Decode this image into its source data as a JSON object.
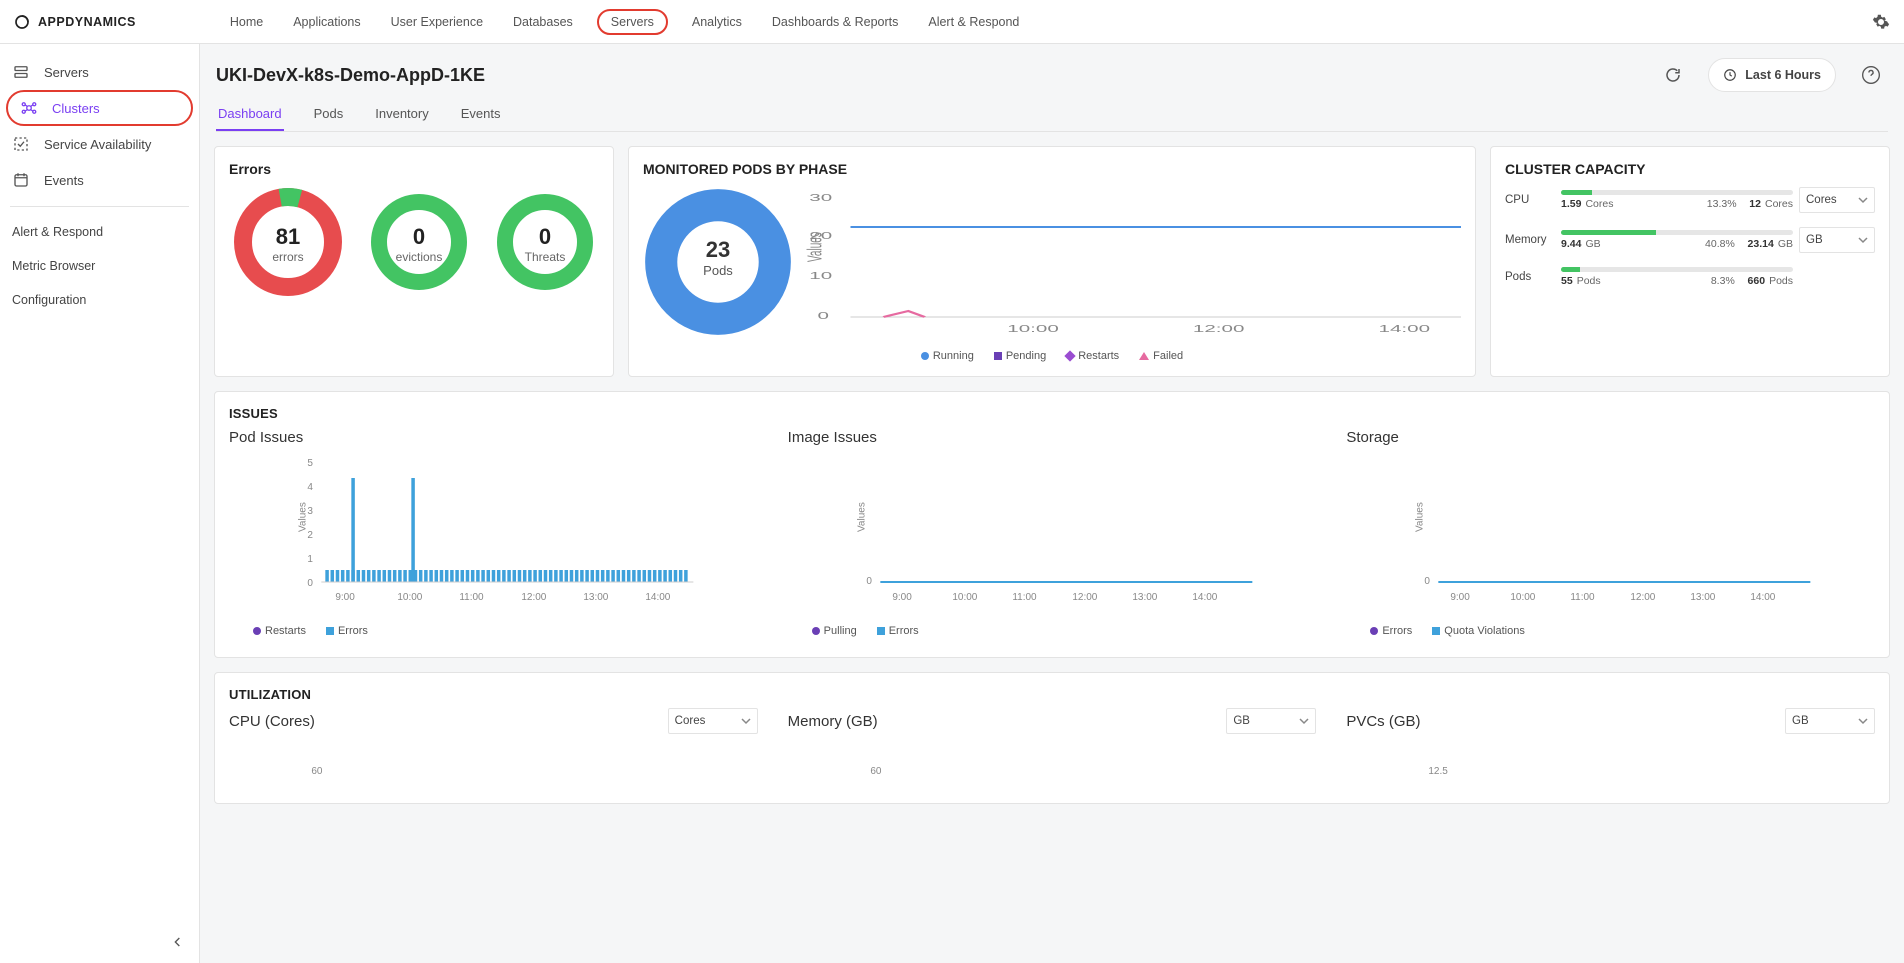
{
  "brand": "APPDYNAMICS",
  "topnav": [
    "Home",
    "Applications",
    "User Experience",
    "Databases",
    "Servers",
    "Analytics",
    "Dashboards & Reports",
    "Alert & Respond"
  ],
  "topnav_highlight": "Servers",
  "sidebar": [
    {
      "label": "Servers",
      "icon": "servers",
      "active": false
    },
    {
      "label": "Clusters",
      "icon": "clusters",
      "active": true,
      "highlight": true
    },
    {
      "label": "Service Availability",
      "icon": "check",
      "active": false
    },
    {
      "label": "Events",
      "icon": "calendar",
      "active": false
    }
  ],
  "sidebar_links": [
    "Alert & Respond",
    "Metric Browser",
    "Configuration"
  ],
  "page_title": "UKI-DevX-k8s-Demo-AppD-1KE",
  "time_range": "Last 6 Hours",
  "subtabs": [
    "Dashboard",
    "Pods",
    "Inventory",
    "Events"
  ],
  "subtab_active": "Dashboard",
  "errors": {
    "title": "Errors",
    "tiles": [
      {
        "value": 81,
        "label": "errors",
        "color": "red",
        "slice_pct": 7
      },
      {
        "value": 0,
        "label": "evictions",
        "color": "green"
      },
      {
        "value": 0,
        "label": "Threats",
        "color": "green"
      }
    ]
  },
  "pods": {
    "title": "MONITORED PODS BY PHASE",
    "count": 23,
    "count_label": "Pods",
    "legend": [
      {
        "label": "Running",
        "color": "#4a90e2",
        "shape": "dot"
      },
      {
        "label": "Pending",
        "color": "#6a3fb5",
        "shape": "sq"
      },
      {
        "label": "Restarts",
        "color": "#9a4dd1",
        "shape": "diamond"
      },
      {
        "label": "Failed",
        "color": "#e66aa0",
        "shape": "tri"
      }
    ]
  },
  "capacity": {
    "title": "CLUSTER CAPACITY",
    "rows": [
      {
        "key": "CPU",
        "value": 1.59,
        "value_unit": "Cores",
        "pct": "13.3%",
        "max": 12,
        "max_unit": "Cores",
        "select": "Cores"
      },
      {
        "key": "Memory",
        "value": 9.44,
        "value_unit": "GB",
        "pct": "40.8%",
        "max": 23.14,
        "max_unit": "GB",
        "select": "GB"
      },
      {
        "key": "Pods",
        "value": 55,
        "value_unit": "Pods",
        "pct": "8.3%",
        "max": 660,
        "max_unit": "Pods"
      }
    ]
  },
  "issues": {
    "title": "ISSUES",
    "cols": [
      {
        "title": "Pod Issues",
        "legend": [
          {
            "label": "Restarts",
            "color": "#6a3fb5",
            "shape": "dot"
          },
          {
            "label": "Errors",
            "color": "#3ea1db",
            "shape": "sq"
          }
        ]
      },
      {
        "title": "Image Issues",
        "legend": [
          {
            "label": "Pulling",
            "color": "#6a3fb5",
            "shape": "dot"
          },
          {
            "label": "Errors",
            "color": "#3ea1db",
            "shape": "sq"
          }
        ]
      },
      {
        "title": "Storage",
        "legend": [
          {
            "label": "Errors",
            "color": "#6a3fb5",
            "shape": "dot"
          },
          {
            "label": "Quota Violations",
            "color": "#3ea1db",
            "shape": "sq"
          }
        ]
      }
    ]
  },
  "utilization": {
    "title": "UTILIZATION",
    "cols": [
      {
        "title": "CPU (Cores)",
        "select": "Cores",
        "first_tick": "60"
      },
      {
        "title": "Memory (GB)",
        "select": "GB",
        "first_tick": "60"
      },
      {
        "title": "PVCs (GB)",
        "select": "GB",
        "first_tick": "12.5"
      }
    ]
  },
  "chart_data": {
    "pods_phase_timeseries": {
      "type": "line",
      "xlabel": "",
      "ylabel": "Values",
      "ylim": [
        0,
        30
      ],
      "x_ticks": [
        "10:00",
        "12:00",
        "14:00"
      ],
      "series": [
        {
          "name": "Running",
          "color": "#4a90e2",
          "flat_value": 23
        },
        {
          "name": "Pending",
          "color": "#6a3fb5",
          "flat_value": 0
        },
        {
          "name": "Restarts",
          "color": "#9a4dd1",
          "flat_value": 0
        },
        {
          "name": "Failed",
          "color": "#e66aa0",
          "flat_value": 0
        }
      ]
    },
    "pod_issues": {
      "type": "bar+line",
      "ylabel": "Values",
      "ylim": [
        0,
        5
      ],
      "x_ticks": [
        "9:00",
        "10:00",
        "11:00",
        "12:00",
        "13:00",
        "14:00"
      ],
      "series": [
        {
          "name": "Errors",
          "color": "#3ea1db",
          "kind": "bar",
          "baseline": 0.6,
          "spikes": [
            {
              "x": "9:10",
              "value": 4
            },
            {
              "x": "9:55",
              "value": 4
            }
          ]
        },
        {
          "name": "Restarts",
          "color": "#6a3fb5",
          "kind": "line",
          "flat_value": 0
        }
      ]
    },
    "image_issues": {
      "type": "line",
      "ylabel": "Values",
      "ylim": [
        0,
        1
      ],
      "x_ticks": [
        "9:00",
        "10:00",
        "11:00",
        "12:00",
        "13:00",
        "14:00"
      ],
      "series": [
        {
          "name": "Pulling",
          "color": "#6a3fb5",
          "flat_value": 0
        },
        {
          "name": "Errors",
          "color": "#3ea1db",
          "flat_value": 0
        }
      ]
    },
    "storage_issues": {
      "type": "line",
      "ylabel": "Values",
      "ylim": [
        0,
        1
      ],
      "x_ticks": [
        "9:00",
        "10:00",
        "11:00",
        "12:00",
        "13:00",
        "14:00"
      ],
      "series": [
        {
          "name": "Errors",
          "color": "#6a3fb5",
          "flat_value": 0
        },
        {
          "name": "Quota Violations",
          "color": "#3ea1db",
          "flat_value": 0
        }
      ]
    },
    "errors_donut": {
      "type": "pie",
      "slices": [
        {
          "label": "green",
          "value": 7,
          "color": "#43c463"
        },
        {
          "label": "red",
          "value": 93,
          "color": "#e74c4e"
        }
      ]
    }
  }
}
